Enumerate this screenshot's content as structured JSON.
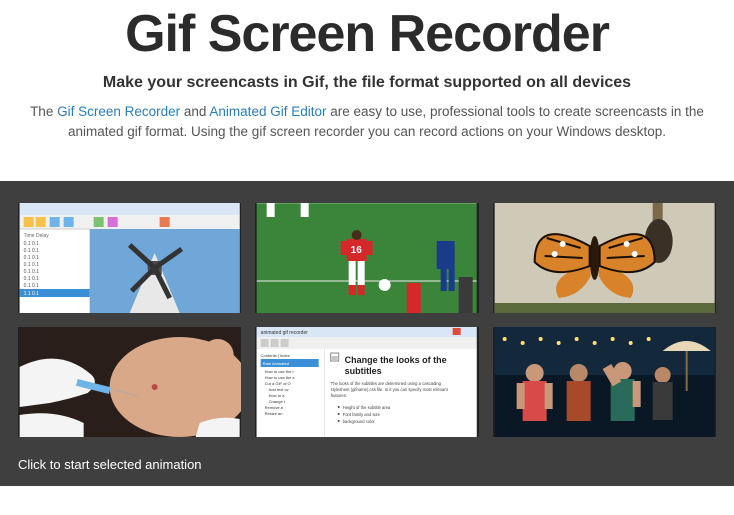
{
  "header": {
    "title": "Gif Screen Recorder",
    "subtitle": "Make your screencasts in Gif, the file format supported on all devices",
    "description_pre": "The ",
    "link1": "Gif Screen Recorder",
    "mid": " and ",
    "link2": "Animated Gif Editor",
    "description_post": " are easy to use, professional tools to create screencasts in the animated gif format. Using the gif screen recorder you can record actions on your Windows desktop."
  },
  "gallery": {
    "caption": "Click to start selected animation",
    "thumbs": [
      {
        "name": "thumb-editor-windmill"
      },
      {
        "name": "thumb-soccer"
      },
      {
        "name": "thumb-butterfly"
      },
      {
        "name": "thumb-medical-foot"
      },
      {
        "name": "thumb-subtitles-help"
      },
      {
        "name": "thumb-party-people"
      }
    ],
    "sub_panel_title": "Change the looks of the subtitles",
    "sub_panel_text": "The looks of the subtitles are determined using a cascading stylesheet (gifname).css file. In it you can specify most relevant features:",
    "sub_panel_bullets": [
      "Height of the subtitle area",
      "Font family and size",
      "background color"
    ]
  }
}
